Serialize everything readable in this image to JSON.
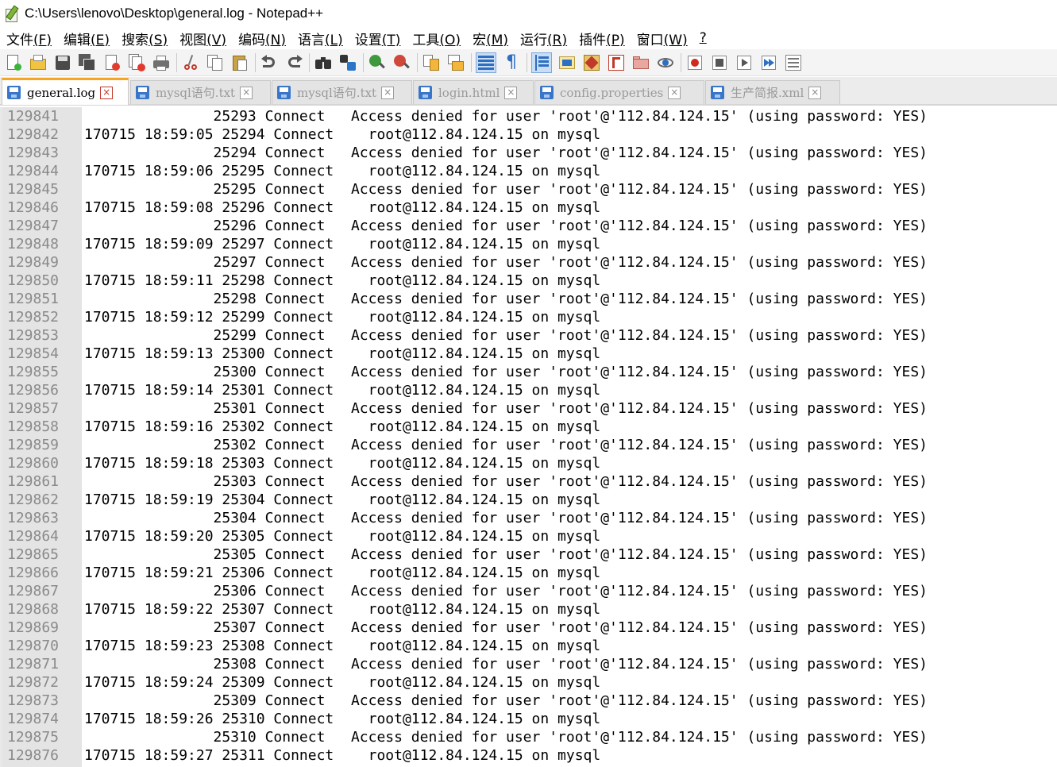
{
  "window": {
    "title": "C:\\Users\\lenovo\\Desktop\\general.log - Notepad++"
  },
  "menu": [
    {
      "label": "文件",
      "key": "(F)"
    },
    {
      "label": "编辑",
      "key": "(E)"
    },
    {
      "label": "搜索",
      "key": "(S)"
    },
    {
      "label": "视图",
      "key": "(V)"
    },
    {
      "label": "编码",
      "key": "(N)"
    },
    {
      "label": "语言",
      "key": "(L)"
    },
    {
      "label": "设置",
      "key": "(T)"
    },
    {
      "label": "工具",
      "key": "(O)"
    },
    {
      "label": "宏",
      "key": "(M)"
    },
    {
      "label": "运行",
      "key": "(R)"
    },
    {
      "label": "插件",
      "key": "(P)"
    },
    {
      "label": "窗口",
      "key": "(W)"
    },
    {
      "label": "",
      "key": "?"
    }
  ],
  "toolbar_icons": [
    "new-file-icon",
    "open-file-icon",
    "save-icon",
    "save-all-icon",
    "close-icon",
    "close-all-icon",
    "print-icon",
    "cut-icon",
    "copy-icon",
    "paste-icon",
    "undo-icon",
    "redo-icon",
    "find-icon",
    "replace-icon",
    "zoom-in-icon",
    "zoom-out-icon",
    "sync-vertical-icon",
    "sync-horizontal-icon",
    "word-wrap-icon",
    "show-all-chars-icon",
    "indent-guide-icon",
    "udl-icon",
    "doc-map-icon",
    "function-list-icon",
    "folder-workspace-icon",
    "monitoring-icon",
    "record-macro-icon",
    "stop-record-icon",
    "play-macro-icon",
    "run-multiple-macro-icon",
    "save-macro-icon"
  ],
  "tabs": [
    {
      "name": "general.log",
      "active": true
    },
    {
      "name": "mysql语句.txt",
      "active": false
    },
    {
      "name": "mysql语句.txt",
      "active": false
    },
    {
      "name": "login.html",
      "active": false
    },
    {
      "name": "config.properties",
      "active": false
    },
    {
      "name": "生产简报.xml",
      "active": false
    }
  ],
  "editor": {
    "lines": [
      {
        "n": "129841",
        "text": "               25293 Connect   Access denied for user 'root'@'112.84.124.15' (using password: YES)"
      },
      {
        "n": "129842",
        "text": "170715 18:59:05 25294 Connect    root@112.84.124.15 on mysql"
      },
      {
        "n": "129843",
        "text": "               25294 Connect   Access denied for user 'root'@'112.84.124.15' (using password: YES)"
      },
      {
        "n": "129844",
        "text": "170715 18:59:06 25295 Connect    root@112.84.124.15 on mysql"
      },
      {
        "n": "129845",
        "text": "               25295 Connect   Access denied for user 'root'@'112.84.124.15' (using password: YES)"
      },
      {
        "n": "129846",
        "text": "170715 18:59:08 25296 Connect    root@112.84.124.15 on mysql"
      },
      {
        "n": "129847",
        "text": "               25296 Connect   Access denied for user 'root'@'112.84.124.15' (using password: YES)"
      },
      {
        "n": "129848",
        "text": "170715 18:59:09 25297 Connect    root@112.84.124.15 on mysql"
      },
      {
        "n": "129849",
        "text": "               25297 Connect   Access denied for user 'root'@'112.84.124.15' (using password: YES)"
      },
      {
        "n": "129850",
        "text": "170715 18:59:11 25298 Connect    root@112.84.124.15 on mysql"
      },
      {
        "n": "129851",
        "text": "               25298 Connect   Access denied for user 'root'@'112.84.124.15' (using password: YES)"
      },
      {
        "n": "129852",
        "text": "170715 18:59:12 25299 Connect    root@112.84.124.15 on mysql"
      },
      {
        "n": "129853",
        "text": "               25299 Connect   Access denied for user 'root'@'112.84.124.15' (using password: YES)"
      },
      {
        "n": "129854",
        "text": "170715 18:59:13 25300 Connect    root@112.84.124.15 on mysql"
      },
      {
        "n": "129855",
        "text": "               25300 Connect   Access denied for user 'root'@'112.84.124.15' (using password: YES)"
      },
      {
        "n": "129856",
        "text": "170715 18:59:14 25301 Connect    root@112.84.124.15 on mysql"
      },
      {
        "n": "129857",
        "text": "               25301 Connect   Access denied for user 'root'@'112.84.124.15' (using password: YES)"
      },
      {
        "n": "129858",
        "text": "170715 18:59:16 25302 Connect    root@112.84.124.15 on mysql"
      },
      {
        "n": "129859",
        "text": "               25302 Connect   Access denied for user 'root'@'112.84.124.15' (using password: YES)"
      },
      {
        "n": "129860",
        "text": "170715 18:59:18 25303 Connect    root@112.84.124.15 on mysql"
      },
      {
        "n": "129861",
        "text": "               25303 Connect   Access denied for user 'root'@'112.84.124.15' (using password: YES)"
      },
      {
        "n": "129862",
        "text": "170715 18:59:19 25304 Connect    root@112.84.124.15 on mysql"
      },
      {
        "n": "129863",
        "text": "               25304 Connect   Access denied for user 'root'@'112.84.124.15' (using password: YES)"
      },
      {
        "n": "129864",
        "text": "170715 18:59:20 25305 Connect    root@112.84.124.15 on mysql"
      },
      {
        "n": "129865",
        "text": "               25305 Connect   Access denied for user 'root'@'112.84.124.15' (using password: YES)"
      },
      {
        "n": "129866",
        "text": "170715 18:59:21 25306 Connect    root@112.84.124.15 on mysql"
      },
      {
        "n": "129867",
        "text": "               25306 Connect   Access denied for user 'root'@'112.84.124.15' (using password: YES)"
      },
      {
        "n": "129868",
        "text": "170715 18:59:22 25307 Connect    root@112.84.124.15 on mysql"
      },
      {
        "n": "129869",
        "text": "               25307 Connect   Access denied for user 'root'@'112.84.124.15' (using password: YES)"
      },
      {
        "n": "129870",
        "text": "170715 18:59:23 25308 Connect    root@112.84.124.15 on mysql"
      },
      {
        "n": "129871",
        "text": "               25308 Connect   Access denied for user 'root'@'112.84.124.15' (using password: YES)"
      },
      {
        "n": "129872",
        "text": "170715 18:59:24 25309 Connect    root@112.84.124.15 on mysql"
      },
      {
        "n": "129873",
        "text": "               25309 Connect   Access denied for user 'root'@'112.84.124.15' (using password: YES)"
      },
      {
        "n": "129874",
        "text": "170715 18:59:26 25310 Connect    root@112.84.124.15 on mysql"
      },
      {
        "n": "129875",
        "text": "               25310 Connect   Access denied for user 'root'@'112.84.124.15' (using password: YES)"
      },
      {
        "n": "129876",
        "text": "170715 18:59:27 25311 Connect    root@112.84.124.15 on mysql"
      }
    ]
  }
}
